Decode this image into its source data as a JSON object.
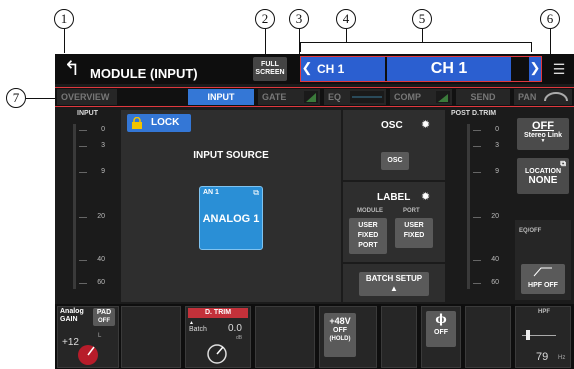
{
  "callouts": [
    "1",
    "2",
    "3",
    "4",
    "5",
    "6",
    "7"
  ],
  "header": {
    "title": "MODULE (INPUT)",
    "fullscreen_line1": "FULL",
    "fullscreen_line2": "SCREEN",
    "prev_arrow": "❮",
    "next_arrow": "❯",
    "channel": "CH 1",
    "channel_name": "CH 1"
  },
  "tabs": [
    {
      "label": "OVERVIEW",
      "active": false
    },
    {
      "label": "INPUT",
      "active": true
    },
    {
      "label": "GATE",
      "active": false
    },
    {
      "label": "EQ",
      "active": false
    },
    {
      "label": "COMP",
      "active": false
    },
    {
      "label": "SEND",
      "active": false
    },
    {
      "label": "PAN",
      "active": false
    }
  ],
  "input_meter": {
    "label": "INPUT",
    "scale": [
      "0",
      "3",
      "9",
      "20",
      "40",
      "60"
    ]
  },
  "post_meter": {
    "label": "POST D.TRIM",
    "scale": [
      "0",
      "3",
      "9",
      "20",
      "40",
      "60"
    ]
  },
  "input_source": {
    "lock_label": "LOCK",
    "title": "INPUT SOURCE",
    "port": "AN 1",
    "name": "ANALOG 1"
  },
  "osc": {
    "title": "OSC",
    "button": "OSC"
  },
  "label_panel": {
    "title": "LABEL",
    "module_tag": "MODULE",
    "port_tag": "PORT",
    "module_btn": [
      "USER",
      "FIXED",
      "PORT"
    ],
    "port_btn": [
      "USER",
      "FIXED"
    ]
  },
  "batch_setup": {
    "label": "BATCH SETUP",
    "arrow": "▲"
  },
  "right_side": {
    "stereo_value": "OFF",
    "stereo_label": "Stereo Link",
    "stereo_arrow": "▼",
    "location_label": "LOCATION",
    "location_value": "NONE",
    "eq_tag": "EQ/OFF",
    "hpf_label": "HPF OFF"
  },
  "bottom": {
    "analog_gain_line1": "Analog",
    "analog_gain_line2": "GAIN",
    "gain_value": "+12",
    "gain_unit": "L",
    "pad_label": "PAD",
    "pad_value": "OFF",
    "dtrim_label": "D. TRIM",
    "batch_label": "Batch",
    "dtrim_value": "0.0",
    "dtrim_unit": "dB",
    "phantom_label": "+48V",
    "phantom_value": "OFF",
    "phantom_sub": "(HOLD)",
    "phase_symbol": "ϕ",
    "phase_value": "OFF",
    "hpf_tag": "HPF",
    "hpf_value": "79",
    "hpf_unit": "Hz"
  },
  "colors": {
    "accent_blue": "#3477d6",
    "source_blue": "#2a8fd6",
    "highlight_red": "#e0383e",
    "dtrim_red": "#c3313a"
  }
}
